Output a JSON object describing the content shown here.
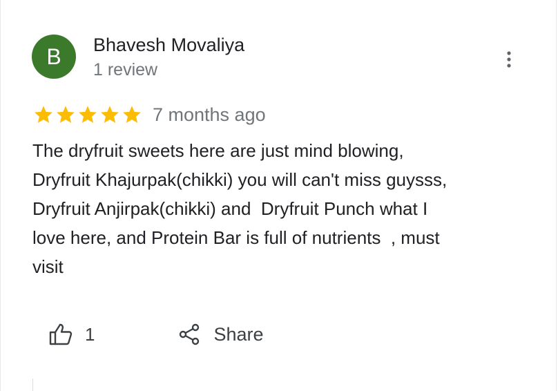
{
  "review": {
    "author": {
      "initial": "B",
      "name": "Bhavesh Movaliya",
      "review_count": "1 review",
      "avatar_color": "#3b7a2a"
    },
    "menu_icon": "more-vert-icon",
    "rating": 5,
    "star_color": "#fbbc04",
    "date": "7 months ago",
    "text": "The dryfruit sweets here are just mind blowing,\nDryfruit Khajurpak(chikki) you will can't miss guysss,\nDryfruit Anjirpak(chikki) and  Dryfruit Punch what I\nlove here, and Protein Bar is full of nutrients  , must\nvisit",
    "actions": {
      "like_icon": "thumb-up-icon",
      "like_count": "1",
      "share_icon": "share-icon",
      "share_label": "Share"
    }
  }
}
